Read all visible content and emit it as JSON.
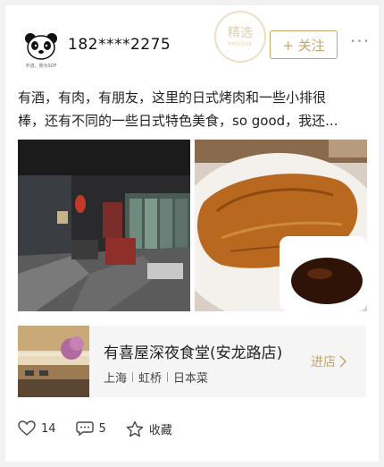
{
  "post": {
    "username": "182****2275",
    "avatar_caption": "手迹，我为SOF",
    "stamp": {
      "title": "精选",
      "subtitle": "YHOUSE"
    },
    "follow_label": "+ 关注",
    "more_label": "···",
    "text_line1": "有酒，有肉，有朋友，这里的日式烤肉和一些小排很",
    "text_line2": "棒，还有不同的一些日式特色美食，so good，我还..."
  },
  "shop": {
    "name": "有喜屋深夜食堂(安龙路店)",
    "tags": [
      "上海",
      "虹桥",
      "日本菜"
    ],
    "enter_label": "进店"
  },
  "actions": {
    "likes": "14",
    "comments": "5",
    "collect_label": "收藏"
  },
  "icons": [
    "panda-avatar",
    "plus-icon",
    "more-icon",
    "chevron-right-icon",
    "heart-icon",
    "comment-icon",
    "star-icon"
  ],
  "colors": {
    "accent": "#c7a465",
    "background": "#f2f2f2",
    "card": "#ffffff"
  }
}
